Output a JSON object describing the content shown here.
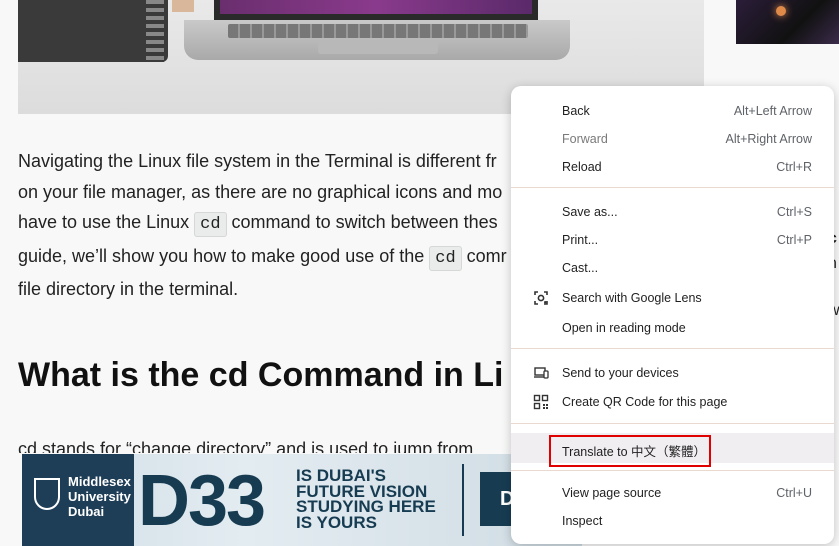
{
  "article": {
    "paragraph": {
      "line1": "Navigating the Linux file system in the Terminal is different fr",
      "line2": "on your file manager, as there are no graphical icons and mo",
      "line3_a": "have to use the Linux ",
      "line3_code": "cd",
      "line3_b": " command to switch between thes",
      "line4_a": "guide, we’ll show you how to make good use of the ",
      "line4_code": "cd",
      "line4_b": " comr",
      "line5": "file directory in the terminal."
    },
    "heading": "What is the cd Command in Li",
    "partial_line": "cd stands for “change directory” and is used to jump from",
    "side_fragments": [
      "c",
      "n",
      "r",
      "w"
    ]
  },
  "ad": {
    "university_line1": "Middlesex",
    "university_line2": "University",
    "university_line3": "Dubai",
    "big_text": "D33",
    "tagline1": "IS DUBAI'S",
    "tagline2": "FUTURE VISION",
    "tagline3": "STUDYING HERE",
    "tagline4": "IS YOURS",
    "cta_fragment": "D"
  },
  "context_menu": {
    "items": [
      {
        "label": "Back",
        "shortcut": "Alt+Left Arrow"
      },
      {
        "label": "Forward",
        "shortcut": "Alt+Right Arrow",
        "disabled": true
      },
      {
        "label": "Reload",
        "shortcut": "Ctrl+R"
      },
      {
        "label": "Save as...",
        "shortcut": "Ctrl+S"
      },
      {
        "label": "Print...",
        "shortcut": "Ctrl+P"
      },
      {
        "label": "Cast...",
        "shortcut": ""
      },
      {
        "label": "Search with Google Lens",
        "shortcut": "",
        "icon": "google-lens-icon"
      },
      {
        "label": "Open in reading mode",
        "shortcut": ""
      },
      {
        "label": "Send to your devices",
        "shortcut": "",
        "icon": "send-to-devices-icon"
      },
      {
        "label": "Create QR Code for this page",
        "shortcut": "",
        "icon": "qr-code-icon"
      },
      {
        "label": "Translate to 中文（繁體）",
        "shortcut": ""
      },
      {
        "label": "View page source",
        "shortcut": "Ctrl+U"
      },
      {
        "label": "Inspect",
        "shortcut": ""
      }
    ],
    "highlight_color": "#e00000"
  }
}
